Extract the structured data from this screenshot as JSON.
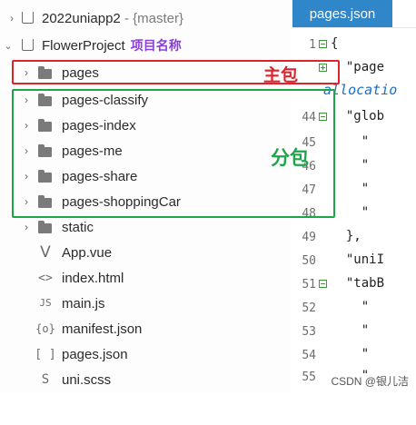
{
  "tree": {
    "workspace": {
      "name": "2022uniapp2",
      "branch": "- {master}"
    },
    "project": {
      "name": "FlowerProject",
      "annotation": "项目名称"
    },
    "items": [
      {
        "label": "pages",
        "kind": "folder"
      },
      {
        "label": "pages-classify",
        "kind": "folder"
      },
      {
        "label": "pages-index",
        "kind": "folder"
      },
      {
        "label": "pages-me",
        "kind": "folder"
      },
      {
        "label": "pages-share",
        "kind": "folder"
      },
      {
        "label": "pages-shoppingCar",
        "kind": "folder"
      },
      {
        "label": "static",
        "kind": "folder"
      },
      {
        "label": "App.vue",
        "kind": "vue",
        "icon": "V"
      },
      {
        "label": "index.html",
        "kind": "html",
        "icon": "<>"
      },
      {
        "label": "main.js",
        "kind": "js",
        "icon": "JS"
      },
      {
        "label": "manifest.json",
        "kind": "json",
        "icon": "{o}"
      },
      {
        "label": "pages.json",
        "kind": "json",
        "icon": "[ ]"
      },
      {
        "label": "uni.scss",
        "kind": "scss",
        "icon": "S"
      }
    ]
  },
  "annotations": {
    "main_package": "主包",
    "sub_package": "分包"
  },
  "editor": {
    "tab": "pages.json",
    "allocation": "allocatio",
    "lines": [
      {
        "num": "1",
        "code": "{"
      },
      {
        "num": "",
        "code": "  \"page"
      },
      {
        "num": "44",
        "code": "  \"glob"
      },
      {
        "num": "45",
        "code": "    \""
      },
      {
        "num": "46",
        "code": "    \""
      },
      {
        "num": "47",
        "code": "    \""
      },
      {
        "num": "48",
        "code": "    \""
      },
      {
        "num": "49",
        "code": "  },"
      },
      {
        "num": "50",
        "code": "  \"uniI"
      },
      {
        "num": "51",
        "code": "  \"tabB"
      },
      {
        "num": "52",
        "code": "    \""
      },
      {
        "num": "53",
        "code": "    \""
      },
      {
        "num": "54",
        "code": "    \""
      },
      {
        "num": "55",
        "code": "    \""
      }
    ]
  },
  "watermark": "CSDN @银儿洁",
  "colors": {
    "main_box": "#e0222c",
    "sub_box": "#1da54a",
    "tab_bg": "#2f86c8",
    "project_tag": "#8b3fd9"
  }
}
